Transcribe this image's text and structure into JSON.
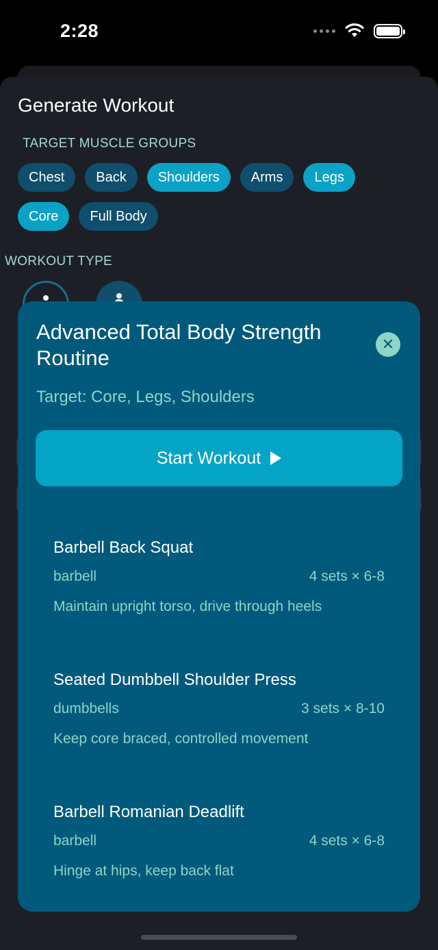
{
  "status": {
    "time": "2:28"
  },
  "generator": {
    "title": "Generate Workout",
    "muscle_label": "TARGET MUSCLE GROUPS",
    "muscles": [
      {
        "label": "Chest",
        "selected": false
      },
      {
        "label": "Back",
        "selected": false
      },
      {
        "label": "Shoulders",
        "selected": true
      },
      {
        "label": "Arms",
        "selected": false
      },
      {
        "label": "Legs",
        "selected": true
      },
      {
        "label": "Core",
        "selected": true
      },
      {
        "label": "Full Body",
        "selected": false
      }
    ],
    "type_label": "WORKOUT TYPE"
  },
  "workout": {
    "title": "Advanced Total Body Strength Routine",
    "target": "Target: Core, Legs, Shoulders",
    "start_label": "Start Workout",
    "exercises": [
      {
        "name": "Barbell Back Squat",
        "equipment": "barbell",
        "sets": "4 sets × 6-8",
        "note": "Maintain upright torso, drive through heels"
      },
      {
        "name": "Seated Dumbbell Shoulder Press",
        "equipment": "dumbbells",
        "sets": "3 sets × 8-10",
        "note": "Keep core braced, controlled movement"
      },
      {
        "name": "Barbell Romanian Deadlift",
        "equipment": "barbell",
        "sets": "4 sets × 6-8",
        "note": "Hinge at hips, keep back flat"
      }
    ]
  },
  "icons": {
    "close": "close-icon",
    "play": "play-icon",
    "wifi": "wifi-icon",
    "battery": "battery-icon",
    "cellular": "cellular-icon"
  },
  "colors": {
    "accent": "#0aa3c6",
    "chip_default": "#0f4e6c",
    "modal_bg": "#015a7c",
    "secondary_text": "#8fd4c6",
    "sheet_bg": "#1c1f26"
  }
}
